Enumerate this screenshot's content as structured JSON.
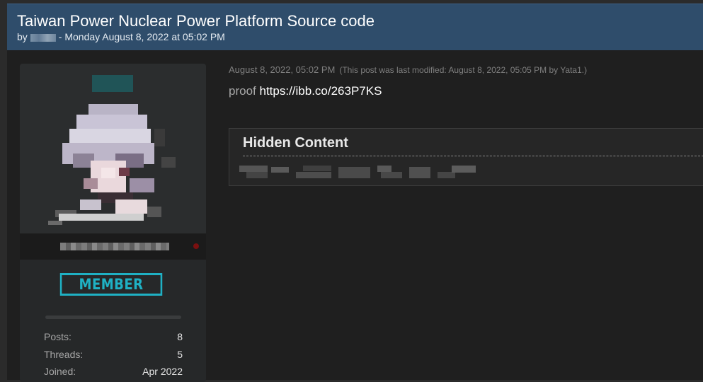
{
  "thread": {
    "title": "Taiwan Power Nuclear Power Platform Source code",
    "by_prefix": "by",
    "date_text": "- Monday August 8, 2022 at 05:02 PM"
  },
  "user": {
    "rank": "MEMBER",
    "stats": [
      {
        "label": "Posts:",
        "value": "8"
      },
      {
        "label": "Threads:",
        "value": "5"
      },
      {
        "label": "Joined:",
        "value": "Apr 2022"
      }
    ]
  },
  "post": {
    "timestamp": "August 8, 2022, 05:02 PM",
    "modified_note": "(This post was last modified: August 8, 2022, 05:05 PM by Yata1.)",
    "body_prefix": "proof",
    "link_text": "https://ibb.co/263P7KS"
  },
  "hidden_content": {
    "title": "Hidden Content"
  },
  "colors": {
    "header_bg": "#2f4d6b",
    "rank_accent": "#1fb1c4",
    "online_status": "#7a1010"
  },
  "icons": {
    "status": "status-dot-icon"
  }
}
